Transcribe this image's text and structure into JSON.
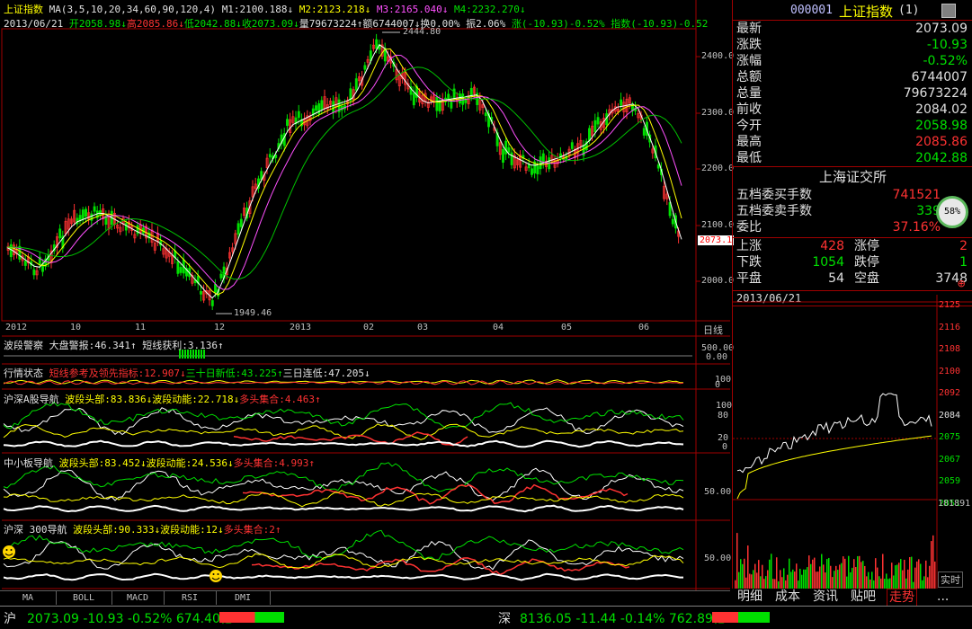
{
  "header": {
    "index_name": "上证指数",
    "ma_params": "MA(3,5,10,20,34,60,90,120,4)",
    "m1": "M1:2100.188↓",
    "m2": "M2:2123.218↓",
    "m3": "M3:2165.040↓",
    "m4": "M4:2232.270↓",
    "date": "2013/06/21",
    "open": "开2058.98↓",
    "high": "高2085.86↓",
    "low": "低2042.88↓",
    "close": "收2073.09↓",
    "volume": "量79673224↑",
    "amount": "额6744007↓",
    "turnover": "换0.00%",
    "amplitude": "振2.06%",
    "change": "涨(-10.93)-0.52%",
    "index_change": "指数(-10.93)-0.52"
  },
  "price_axis": [
    "2400.0",
    "2300.0",
    "2200.0",
    "2100.0",
    "2000.0"
  ],
  "price_marker": "2073.1",
  "high_label": "2444.80",
  "low_label": "1949.46",
  "time_axis": [
    "2012",
    "10",
    "11",
    "12",
    "2013",
    "02",
    "03",
    "04",
    "05",
    "06",
    "日线"
  ],
  "indicators": [
    {
      "title": "波段警察",
      "text": "大盘警报:46.341↑ 短线获利:3.136↑",
      "axis": [
        "500.00",
        "0.00"
      ]
    },
    {
      "title": "行情状态",
      "text_a": "短线参考及领先指标:12.907↓",
      "text_b": "三十日新低:43.225↑",
      "text_c": "三日连低:47.205↓",
      "axis": [
        "100",
        "0"
      ]
    },
    {
      "title": "沪深A股导航",
      "text_a": "波段头部:83.836↓",
      "text_b": "波段动能:22.718↓",
      "text_c": "多头集合:4.463↑",
      "axis": [
        "100",
        "80",
        "20",
        "0"
      ]
    },
    {
      "title": "中小板导航",
      "text_a": "波段头部:83.452↓",
      "text_b": "波段动能:24.536↓",
      "text_c": "多头集合:4.993↑",
      "axis": [
        "50.00"
      ]
    },
    {
      "title": "沪深 300导航",
      "text_a": "波段头部:90.333↓",
      "text_b": "波段动能:12↓",
      "text_c": "多头集合:2↑",
      "axis": [
        "50.00"
      ]
    }
  ],
  "bottom_tabs": [
    "MA",
    "BOLL",
    "MACD",
    "RSI",
    "DMI"
  ],
  "right_panel": {
    "code": "000001",
    "name": "上证指数",
    "suffix": "(1)",
    "quotes": [
      {
        "label": "最新",
        "value": "2073.09",
        "color": "#e0e0e0"
      },
      {
        "label": "涨跌",
        "value": "-10.93",
        "color": "#00e000"
      },
      {
        "label": "涨幅",
        "value": "-0.52%",
        "color": "#00e000"
      },
      {
        "label": "总额",
        "value": "6744007",
        "color": "#e0e0e0"
      },
      {
        "label": "总量",
        "value": "79673224",
        "color": "#e0e0e0"
      },
      {
        "label": "前收",
        "value": "2084.02",
        "color": "#e0e0e0"
      },
      {
        "label": "今开",
        "value": "2058.98",
        "color": "#00e000"
      },
      {
        "label": "最高",
        "value": "2085.86",
        "color": "#ff3232"
      },
      {
        "label": "最低",
        "value": "2042.88",
        "color": "#00e000"
      }
    ],
    "exchange": "上海证交所",
    "orders": [
      {
        "label": "五档委买手数",
        "value": "741521",
        "color": "#ff3232"
      },
      {
        "label": "五档委卖手数",
        "value": "339",
        "color": "#00e000"
      },
      {
        "label": "委比",
        "value": "37.16%",
        "color": "#ff3232"
      }
    ],
    "breadth": [
      {
        "l1": "上涨",
        "v1": "428",
        "c1": "#ff3232",
        "l2": "涨停",
        "v2": "2",
        "c2": "#ff3232"
      },
      {
        "l1": "下跌",
        "v1": "1054",
        "c1": "#00e000",
        "l2": "跌停",
        "v2": "1",
        "c2": "#00e000"
      },
      {
        "l1": "平盘",
        "v1": "54",
        "c1": "#e0e0e0",
        "l2": "空盘",
        "v2": "3748",
        "c2": "#e0e0e0"
      }
    ],
    "circle_badge": "58%",
    "intraday_date": "2013/06/21",
    "intraday_axis": [
      "2125",
      "2116",
      "2108",
      "2100",
      "2092",
      "2084",
      "2075",
      "2067",
      "2059",
      "2051"
    ],
    "volume_max": "181891",
    "realtime_btn": "实时",
    "tabs": [
      "明细",
      "成本",
      "资讯",
      "贴吧",
      "走势",
      "..."
    ]
  },
  "status_bar": {
    "sh_label": "沪",
    "sh_value": "2073.09 -10.93 -0.52% 674.40亿",
    "sz_label": "深",
    "sz_value": "8136.05 -11.44 -0.14% 762.89亿"
  },
  "colors": {
    "up": "#ff3232",
    "down": "#00e000",
    "ma_white": "#ffffff",
    "ma_yellow": "#ffff00",
    "ma_magenta": "#ff50ff",
    "ma_green": "#00c000"
  }
}
